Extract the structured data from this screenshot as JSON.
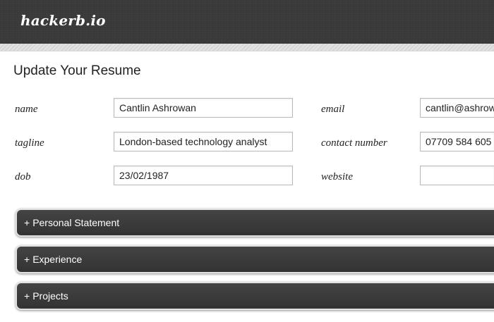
{
  "header": {
    "logo": "hackerb.io"
  },
  "page": {
    "title": "Update Your Resume"
  },
  "form": {
    "name": {
      "label": "name",
      "value": "Cantlin Ashrowan"
    },
    "tagline": {
      "label": "tagline",
      "value": "London-based technology analyst"
    },
    "dob": {
      "label": "dob",
      "value": "23/02/1987"
    },
    "email": {
      "label": "email",
      "value": "cantlin@ashrowan.com"
    },
    "contact": {
      "label": "contact number",
      "value": "07709 584 605"
    },
    "website": {
      "label": "website",
      "value": ""
    }
  },
  "sections": [
    {
      "prefix": "+",
      "label": "Personal Statement"
    },
    {
      "prefix": "+",
      "label": "Experience"
    },
    {
      "prefix": "+",
      "label": "Projects"
    }
  ]
}
